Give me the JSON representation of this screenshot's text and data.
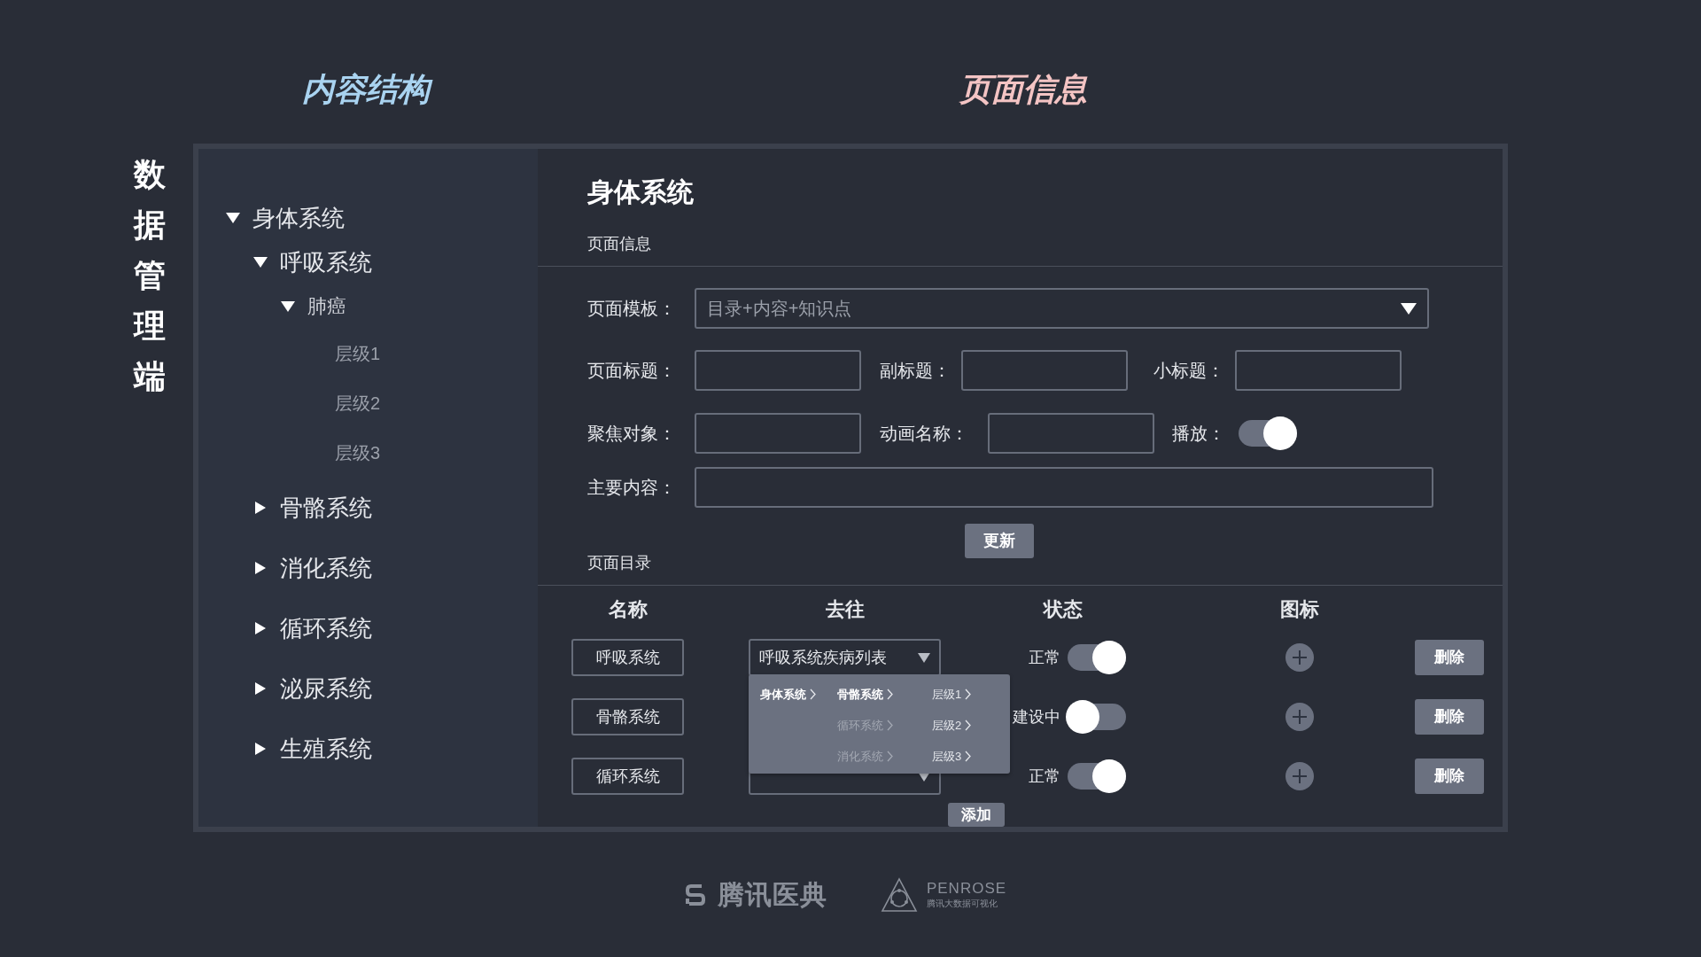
{
  "headings": {
    "structure": "内容结构",
    "page_info": "页面信息"
  },
  "vertical_title": "数据管理端",
  "tree": [
    {
      "label": "身体系统",
      "expanded": true,
      "children": [
        {
          "label": "呼吸系统",
          "expanded": true,
          "children": [
            {
              "label": "肺癌",
              "expanded": true,
              "children": [
                {
                  "label": "层级1"
                },
                {
                  "label": "层级2"
                },
                {
                  "label": "层级3"
                }
              ]
            }
          ]
        },
        {
          "label": "骨骼系统",
          "expanded": false
        },
        {
          "label": "消化系统",
          "expanded": false
        },
        {
          "label": "循环系统",
          "expanded": false
        },
        {
          "label": "泌尿系统",
          "expanded": false
        },
        {
          "label": "生殖系统",
          "expanded": false
        }
      ]
    }
  ],
  "page_title": "身体系统",
  "info_section": "页面信息",
  "form_rows": [
    [
      {
        "kind": "select",
        "label": "页面模板：",
        "value": "目录+内容+知识点"
      }
    ],
    [
      {
        "kind": "input",
        "label": "页面标题："
      },
      {
        "kind": "input",
        "label": "副标题："
      },
      {
        "kind": "input",
        "label": "小标题："
      }
    ],
    [
      {
        "kind": "input",
        "label": "聚焦对象："
      },
      {
        "kind": "input",
        "label": "动画名称："
      },
      {
        "kind": "toggle",
        "label": "播放：",
        "on": true
      }
    ],
    [
      {
        "kind": "wide",
        "label": "主要内容："
      }
    ]
  ],
  "update_button": "更新",
  "catalog_section": "页面目录",
  "columns": [
    "名称",
    "去往",
    "状态",
    "图标"
  ],
  "rows": [
    {
      "name": "呼吸系统",
      "select": true,
      "destination": "呼吸系统疾病列表",
      "status": "正常",
      "on": true,
      "delete": "删除"
    },
    {
      "name": "骨骼系统",
      "select": false,
      "status": "建设中",
      "on": false,
      "delete": "删除"
    },
    {
      "name": "循环系统",
      "select": true,
      "status": "正常",
      "on": true,
      "delete": "删除"
    }
  ],
  "menu": [
    [
      {
        "label": "身体系统",
        "selected": true,
        "muted": false
      }
    ],
    [
      {
        "label": "骨骼系统",
        "selected": true,
        "muted": false
      },
      {
        "label": "循环系统",
        "selected": false,
        "muted": true
      },
      {
        "label": "消化系统",
        "selected": false,
        "muted": true
      }
    ],
    [
      {
        "label": "层级1",
        "selected": false,
        "muted": false
      },
      {
        "label": "层级2",
        "selected": false,
        "muted": false
      },
      {
        "label": "层级3",
        "selected": false,
        "muted": false
      }
    ]
  ],
  "add_button": "添加",
  "footer": {
    "brand": "腾讯医典",
    "partner": "PENROSE",
    "partner_tagline": "腾讯大数据可视化"
  }
}
